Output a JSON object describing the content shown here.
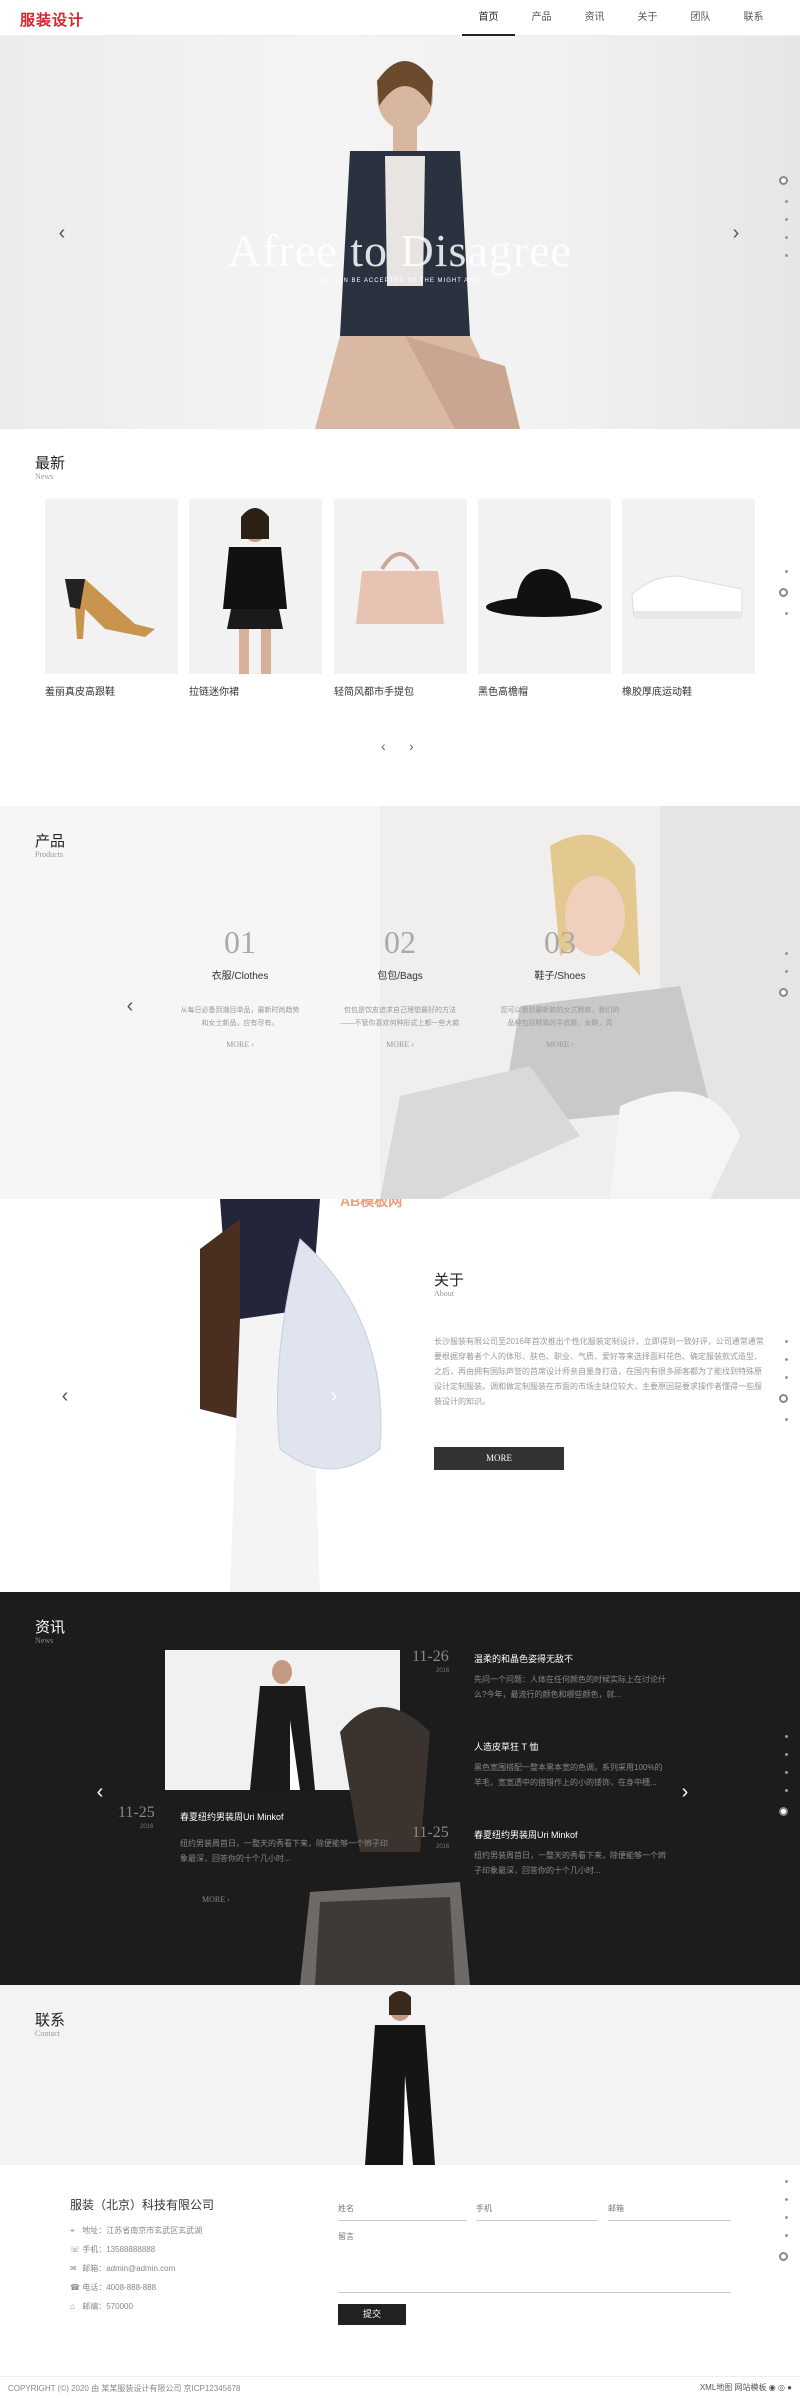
{
  "header": {
    "logo": "服装设计",
    "nav": [
      "首页",
      "产品",
      "资讯",
      "关于",
      "团队",
      "联系"
    ]
  },
  "hero": {
    "title": "Afree to Disagree",
    "subtitle": "YOU CAN BE ACCEPTED TO THE MIGHT ARMY"
  },
  "news": {
    "title": "最新",
    "subtitle": "News",
    "items": [
      "羞丽真皮高跟鞋",
      "拉链迷你裙",
      "轻简风都市手提包",
      "黑色高檐帽",
      "橡胶厚底运动鞋"
    ],
    "prev": "‹",
    "next": "›"
  },
  "products": {
    "title": "产品",
    "subtitle": "Products",
    "items": [
      {
        "num": "01",
        "name": "衣服/Clothes",
        "desc": "从每日必备到潮目单品，最新时尚趋势和女士新品，应有尽有。",
        "more": "MORE"
      },
      {
        "num": "02",
        "name": "包包/Bags",
        "desc": "包包是饮皮追求自己理想最好的方法——不管你喜欢何种形式上都一些大款",
        "more": "MORE"
      },
      {
        "num": "03",
        "name": "鞋子/Shoes",
        "desc": "您可以看到最新款的女式鞋款，我们的品种包括精致的平底鞋，女鞋，高",
        "more": "MORE"
      }
    ]
  },
  "about": {
    "title": "关于",
    "subtitle": "About",
    "text": "长沙服装有限公司至2016年首次推出个性化服装定制设计，立即得到一致好评，公司通常通常要根据穿着者个人的体形、肤色、职业、气质、爱好等来选择面料花色、确定服装款式造型、之后，再由拥有国际声誉的首席设计师亲自量身打造，在国内有很多顾客都为了能找到特殊原设计定制服装。调和做定制服装在市面的市场主缺位较大，主要原因是要求操作者懂得一些服装设计的知识。",
    "more": "MORE"
  },
  "newsdark": {
    "title": "资讯",
    "subtitle": "News",
    "left": {
      "date": "11-25",
      "year": "2016",
      "title": "春夏纽约男装周Uri Minkof",
      "desc": "纽约男装周首日，一整天的秀看下来，除便能够一个辫子印象最深，回答你的十个几小时...",
      "more": "MORE"
    },
    "top": {
      "date": "11-26",
      "year": "2016"
    },
    "right": [
      {
        "title": "温柔的和晶色姿得无敌不",
        "desc": "先问一个问题：人体在任何颜色的时候实际上在讨论什么?今年，最流行的颜色和哪些颜色，就..."
      },
      {
        "title": "人造皮草狂 T 恤",
        "desc": "黑色宽围搭配一整本黑本宽的色调，系列采用100%的羊毛，宽宽透中的搭错作上的小的镂饰，在身中穗..."
      },
      {
        "title": "春夏纽约男装周Uri Minkof",
        "desc": "纽约男装周首日，一整天的秀看下来，除便能够一个辫子印象最深，回答你的十个几小时..."
      }
    ],
    "right_date": {
      "date": "11-25",
      "year": "2016"
    }
  },
  "contact": {
    "title": "联系",
    "subtitle": "Contact",
    "company": "服装（北京）科技有限公司",
    "info": [
      {
        "icon": "location-icon",
        "glyph": "⌖",
        "text": "地址：江苏省南京市玄武区玄武湖"
      },
      {
        "icon": "phone-icon",
        "glyph": "☏",
        "text": "手机：13588888888"
      },
      {
        "icon": "mail-icon",
        "glyph": "✉",
        "text": "邮箱：admin@admin.com"
      },
      {
        "icon": "tel-icon",
        "glyph": "☎",
        "text": "电话：4008-888-888"
      },
      {
        "icon": "fax-icon",
        "glyph": "⌂",
        "text": "邮编：570000"
      }
    ],
    "form": {
      "name": "姓名",
      "mobile": "手机",
      "email": "邮箱",
      "message": "留言",
      "submit": "提交"
    }
  },
  "footer": {
    "copyright": "COPYRIGHT (©) 2020 由 某某服装设计有限公司 京ICP12345678",
    "links": "XML地图 网站模板"
  },
  "watermark": "AB模板网"
}
